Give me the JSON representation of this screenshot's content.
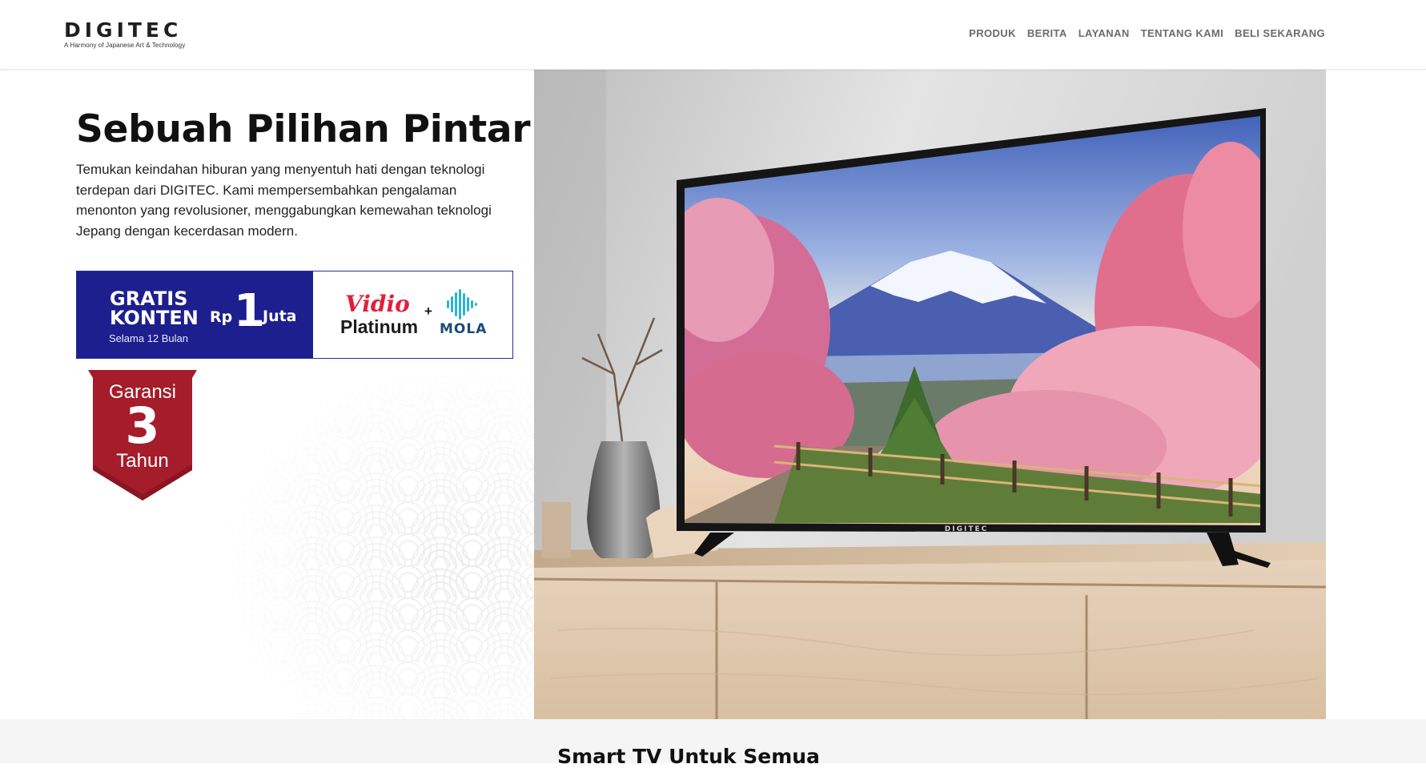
{
  "header": {
    "logo_text": "DIGITEC",
    "logo_tagline": "A Harmony of Japanese Art & Technology",
    "nav": [
      "PRODUK",
      "BERITA",
      "LAYANAN",
      "TENTANG KAMI",
      "BELI SEKARANG"
    ]
  },
  "hero": {
    "title": "Sebuah Pilihan Pintar",
    "description": "Temukan keindahan hiburan yang menyentuh hati dengan teknologi terdepan dari DIGITEC. Kami mempersembahkan pengalaman menonton yang revolusioner, menggabungkan kemewahan teknologi Jepang dengan kecerdasan modern.",
    "promo": {
      "gratis_line1": "GRATIS",
      "gratis_line2": "KONTEN",
      "duration": "Selama 12 Bulan",
      "currency": "Rp",
      "amount": "1",
      "unit": "Juta",
      "partner1_top": "Vidio",
      "partner1_bottom": "Platinum",
      "plus": "+",
      "partner2": "MOLA"
    },
    "warranty": {
      "top": "Garansi",
      "number": "3",
      "bottom": "Tahun"
    },
    "tv_brand": "DIGITEC"
  },
  "section": {
    "title": "Smart TV Untuk Semua"
  },
  "colors": {
    "promo_blue": "#1e1f8e",
    "warranty_red": "#a51c2a",
    "vidio_red": "#e0203b",
    "nav_gray": "#6b6b6b"
  }
}
